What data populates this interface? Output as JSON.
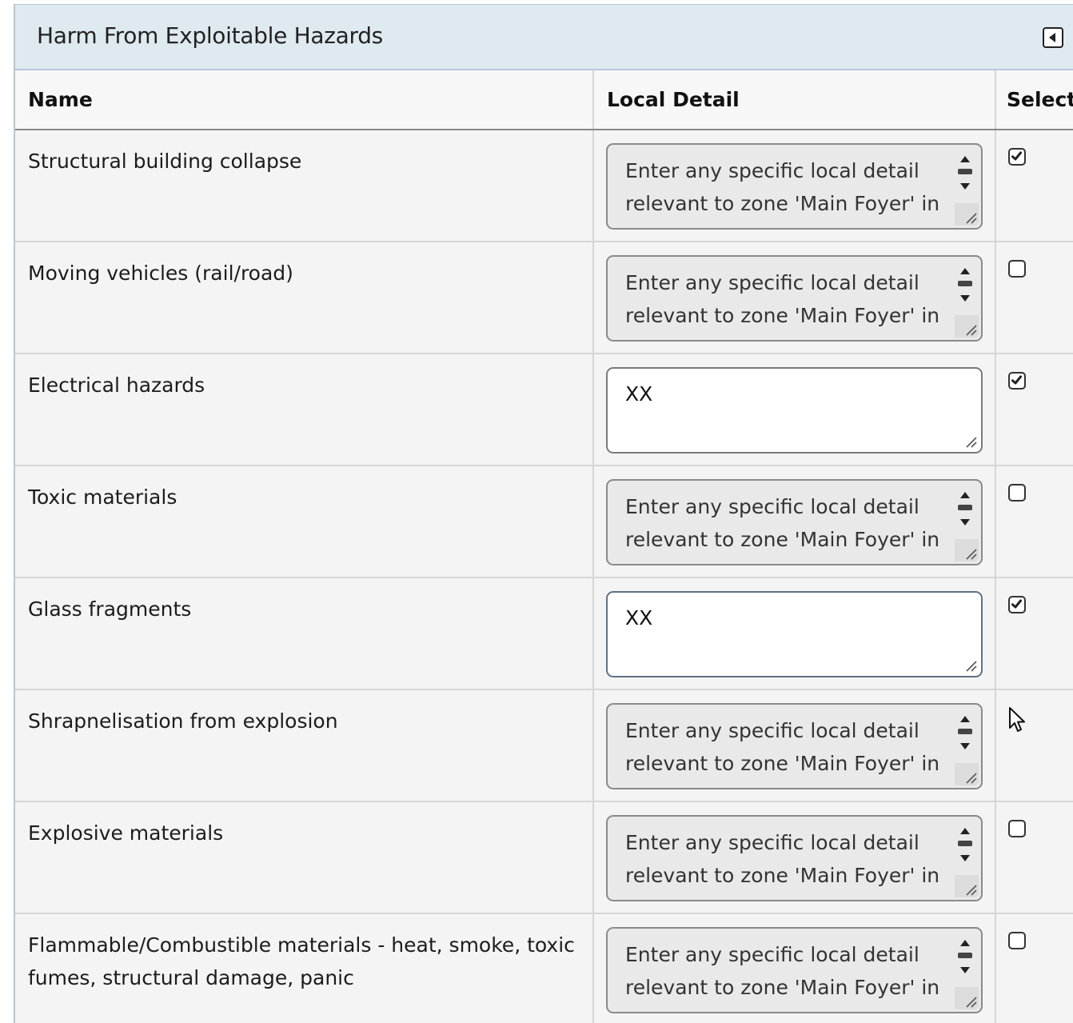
{
  "panel": {
    "title": "Harm From Exploitable Hazards"
  },
  "table": {
    "headers": {
      "name": "Name",
      "detail": "Local Detail",
      "select": "Select"
    },
    "rows": [
      {
        "name": "Structural building collapse",
        "detail": "Enter any specific local detail relevant to zone 'Main Foyer' in",
        "selected": true
      },
      {
        "name": "Moving vehicles (rail/road)",
        "detail": "Enter any specific local detail relevant to zone 'Main Foyer' in",
        "selected": false
      },
      {
        "name": "Electrical hazards",
        "detail": "XX",
        "selected": true
      },
      {
        "name": "Toxic materials",
        "detail": "Enter any specific local detail relevant to zone 'Main Foyer' in",
        "selected": false
      },
      {
        "name": "Glass fragments",
        "detail": "XX",
        "selected": true
      },
      {
        "name": "Shrapnelisation from explosion",
        "detail": "Enter any specific local detail relevant to zone 'Main Foyer' in",
        "selected": false
      },
      {
        "name": "Explosive materials",
        "detail": "Enter any specific local detail relevant to zone 'Main Foyer' in",
        "selected": false
      },
      {
        "name": "Flammable/Combustible materials - heat, smoke, toxic fumes, structural damage, panic",
        "detail": "Enter any specific local detail relevant to zone 'Main Foyer' in",
        "selected": false
      }
    ]
  }
}
